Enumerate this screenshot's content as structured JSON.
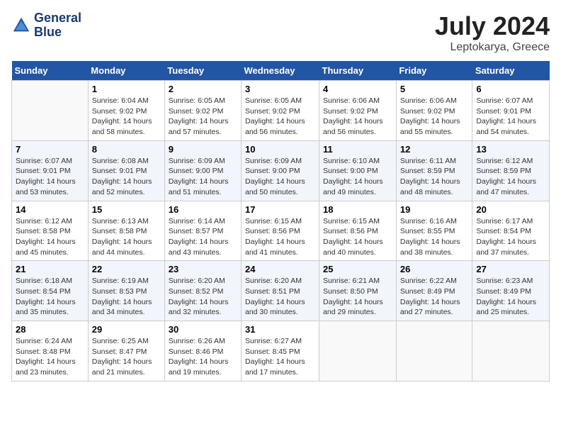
{
  "header": {
    "logo_line1": "General",
    "logo_line2": "Blue",
    "month": "July 2024",
    "location": "Leptokarya, Greece"
  },
  "weekdays": [
    "Sunday",
    "Monday",
    "Tuesday",
    "Wednesday",
    "Thursday",
    "Friday",
    "Saturday"
  ],
  "weeks": [
    [
      {
        "day": "",
        "empty": true
      },
      {
        "day": "1",
        "sunrise": "6:04 AM",
        "sunset": "9:02 PM",
        "daylight": "14 hours and 58 minutes."
      },
      {
        "day": "2",
        "sunrise": "6:05 AM",
        "sunset": "9:02 PM",
        "daylight": "14 hours and 57 minutes."
      },
      {
        "day": "3",
        "sunrise": "6:05 AM",
        "sunset": "9:02 PM",
        "daylight": "14 hours and 56 minutes."
      },
      {
        "day": "4",
        "sunrise": "6:06 AM",
        "sunset": "9:02 PM",
        "daylight": "14 hours and 56 minutes."
      },
      {
        "day": "5",
        "sunrise": "6:06 AM",
        "sunset": "9:02 PM",
        "daylight": "14 hours and 55 minutes."
      },
      {
        "day": "6",
        "sunrise": "6:07 AM",
        "sunset": "9:01 PM",
        "daylight": "14 hours and 54 minutes."
      }
    ],
    [
      {
        "day": "7",
        "sunrise": "6:07 AM",
        "sunset": "9:01 PM",
        "daylight": "14 hours and 53 minutes."
      },
      {
        "day": "8",
        "sunrise": "6:08 AM",
        "sunset": "9:01 PM",
        "daylight": "14 hours and 52 minutes."
      },
      {
        "day": "9",
        "sunrise": "6:09 AM",
        "sunset": "9:00 PM",
        "daylight": "14 hours and 51 minutes."
      },
      {
        "day": "10",
        "sunrise": "6:09 AM",
        "sunset": "9:00 PM",
        "daylight": "14 hours and 50 minutes."
      },
      {
        "day": "11",
        "sunrise": "6:10 AM",
        "sunset": "9:00 PM",
        "daylight": "14 hours and 49 minutes."
      },
      {
        "day": "12",
        "sunrise": "6:11 AM",
        "sunset": "8:59 PM",
        "daylight": "14 hours and 48 minutes."
      },
      {
        "day": "13",
        "sunrise": "6:12 AM",
        "sunset": "8:59 PM",
        "daylight": "14 hours and 47 minutes."
      }
    ],
    [
      {
        "day": "14",
        "sunrise": "6:12 AM",
        "sunset": "8:58 PM",
        "daylight": "14 hours and 45 minutes."
      },
      {
        "day": "15",
        "sunrise": "6:13 AM",
        "sunset": "8:58 PM",
        "daylight": "14 hours and 44 minutes."
      },
      {
        "day": "16",
        "sunrise": "6:14 AM",
        "sunset": "8:57 PM",
        "daylight": "14 hours and 43 minutes."
      },
      {
        "day": "17",
        "sunrise": "6:15 AM",
        "sunset": "8:56 PM",
        "daylight": "14 hours and 41 minutes."
      },
      {
        "day": "18",
        "sunrise": "6:15 AM",
        "sunset": "8:56 PM",
        "daylight": "14 hours and 40 minutes."
      },
      {
        "day": "19",
        "sunrise": "6:16 AM",
        "sunset": "8:55 PM",
        "daylight": "14 hours and 38 minutes."
      },
      {
        "day": "20",
        "sunrise": "6:17 AM",
        "sunset": "8:54 PM",
        "daylight": "14 hours and 37 minutes."
      }
    ],
    [
      {
        "day": "21",
        "sunrise": "6:18 AM",
        "sunset": "8:54 PM",
        "daylight": "14 hours and 35 minutes."
      },
      {
        "day": "22",
        "sunrise": "6:19 AM",
        "sunset": "8:53 PM",
        "daylight": "14 hours and 34 minutes."
      },
      {
        "day": "23",
        "sunrise": "6:20 AM",
        "sunset": "8:52 PM",
        "daylight": "14 hours and 32 minutes."
      },
      {
        "day": "24",
        "sunrise": "6:20 AM",
        "sunset": "8:51 PM",
        "daylight": "14 hours and 30 minutes."
      },
      {
        "day": "25",
        "sunrise": "6:21 AM",
        "sunset": "8:50 PM",
        "daylight": "14 hours and 29 minutes."
      },
      {
        "day": "26",
        "sunrise": "6:22 AM",
        "sunset": "8:49 PM",
        "daylight": "14 hours and 27 minutes."
      },
      {
        "day": "27",
        "sunrise": "6:23 AM",
        "sunset": "8:49 PM",
        "daylight": "14 hours and 25 minutes."
      }
    ],
    [
      {
        "day": "28",
        "sunrise": "6:24 AM",
        "sunset": "8:48 PM",
        "daylight": "14 hours and 23 minutes."
      },
      {
        "day": "29",
        "sunrise": "6:25 AM",
        "sunset": "8:47 PM",
        "daylight": "14 hours and 21 minutes."
      },
      {
        "day": "30",
        "sunrise": "6:26 AM",
        "sunset": "8:46 PM",
        "daylight": "14 hours and 19 minutes."
      },
      {
        "day": "31",
        "sunrise": "6:27 AM",
        "sunset": "8:45 PM",
        "daylight": "14 hours and 17 minutes."
      },
      {
        "day": "",
        "empty": true
      },
      {
        "day": "",
        "empty": true
      },
      {
        "day": "",
        "empty": true
      }
    ]
  ]
}
